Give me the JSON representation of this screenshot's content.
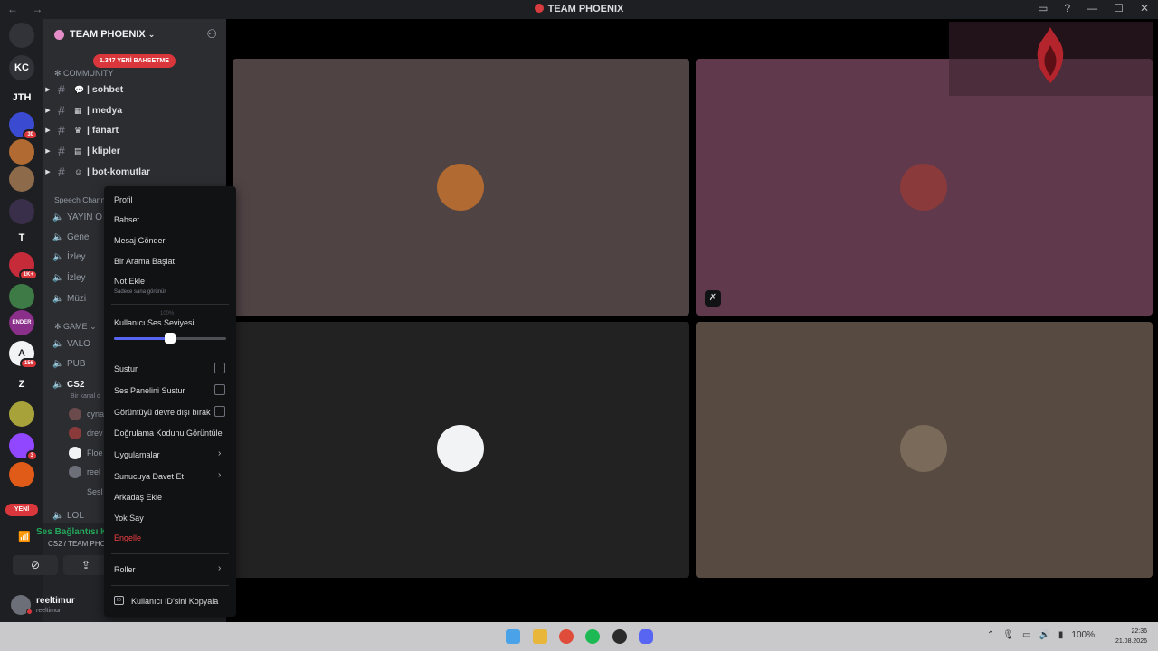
{
  "window": {
    "title": "TEAM PHOENIX",
    "nav_glyphs": "← →",
    "controls": [
      "▭",
      "?",
      "—",
      "☐",
      "✕"
    ]
  },
  "guilds": {
    "items": [
      {
        "name": "discord-home-icon",
        "label": "",
        "color": "#313338"
      },
      {
        "name": "guild-kc",
        "label": "KC",
        "color": "#313338"
      },
      {
        "name": "guild-jth",
        "label": "JTH",
        "color": "#1e1f22"
      },
      {
        "name": "guild-blue",
        "label": "",
        "color": "#3b4bd1",
        "badge": "30"
      },
      {
        "name": "guild-tiger",
        "label": "",
        "color": "#b06a32"
      },
      {
        "name": "guild-face",
        "label": "",
        "color": "#8d6b4a"
      },
      {
        "name": "guild-figure",
        "label": "",
        "color": "#3a2f4a"
      },
      {
        "name": "guild-t",
        "label": "T",
        "color": "#1e1f22"
      },
      {
        "name": "guild-red",
        "label": "",
        "color": "#c62b3a",
        "badge": "1K+"
      },
      {
        "name": "guild-green",
        "label": "",
        "color": "#3d7a46"
      },
      {
        "name": "guild-ender",
        "label": "ENDER",
        "color": "#8a2f8a"
      },
      {
        "name": "guild-a",
        "label": "A",
        "color": "#f2f3f5",
        "badge": "156"
      },
      {
        "name": "guild-z",
        "label": "Z",
        "color": "#1e1f22"
      },
      {
        "name": "guild-yellow",
        "label": "",
        "color": "#a8a23a"
      },
      {
        "name": "guild-twitch",
        "label": "",
        "color": "#9146ff",
        "badge": "3"
      },
      {
        "name": "guild-orange",
        "label": "",
        "color": "#e05b18"
      }
    ],
    "new_label": "YENİ"
  },
  "server": {
    "name": "TEAM PHOENIX",
    "mention_pill": "1.347 YENİ BAHSETME",
    "categories": {
      "community": "COMMUNITY",
      "speech": "Speech Chann",
      "game": "GAME"
    },
    "text_channels": [
      {
        "icon": "💬",
        "name": "sohbet"
      },
      {
        "icon": "▦",
        "name": "medya"
      },
      {
        "icon": "♛",
        "name": "fanart"
      },
      {
        "icon": "▤",
        "name": "klipler"
      },
      {
        "icon": "☺",
        "name": "bot-komutlar"
      }
    ],
    "voice_channels_speech": [
      "YAYIN O",
      "Gene",
      "İzley",
      "İzley",
      "Müzi"
    ],
    "voice_channels_game": [
      "VALO",
      "PUB",
      "CS2"
    ],
    "cs2_subtitle": "Bir kanal d",
    "voice_users": [
      "cyna",
      "drev",
      "Floe",
      "reel",
      "Sesl"
    ],
    "lol_channel": "LOL"
  },
  "voice_status": {
    "status": "Ses Bağlantısı K",
    "where": "CS2 / TEAM PHOE"
  },
  "user": {
    "name": "reeltimur",
    "tag": "reeltimur"
  },
  "context_menu": {
    "profile": "Profil",
    "mention": "Bahset",
    "message": "Mesaj Gönder",
    "call": "Bir Arama Başlat",
    "add_note": "Not Ekle",
    "add_note_sub": "Sadece sana görünür",
    "volume_label": "Kullanıcı Ses Seviyesi",
    "volume_pct": "100%",
    "volume_level": 0.5,
    "mute": "Sustur",
    "soundboard_mute": "Ses Panelini Sustur",
    "video_disable": "Görüntüyü devre dışı bırak",
    "verify_code": "Doğrulama Kodunu Görüntüle",
    "apps": "Uygulamalar",
    "invite": "Sunucuya Davet Et",
    "add_friend": "Arkadaş Ekle",
    "ignore": "Yok Say",
    "block": "Engelle",
    "roles": "Roller",
    "copy_id": "Kullanıcı ID'sini Kopyala",
    "id_badge": "ID"
  },
  "tiles": [
    {
      "name": "tile-user-1",
      "bg": "#4f4344",
      "avatar": "#b06a32"
    },
    {
      "name": "tile-user-2",
      "bg": "#603a4c",
      "avatar": "#8a3a3a"
    },
    {
      "name": "tile-user-3",
      "bg": "#232222",
      "avatar": "#f2f3f5"
    },
    {
      "name": "tile-user-4",
      "bg": "#574a40",
      "avatar": "#7a6a5a"
    }
  ],
  "taskbar": {
    "clock_time": "22:36",
    "clock_date": "21.08.2026",
    "battery": "100%"
  }
}
